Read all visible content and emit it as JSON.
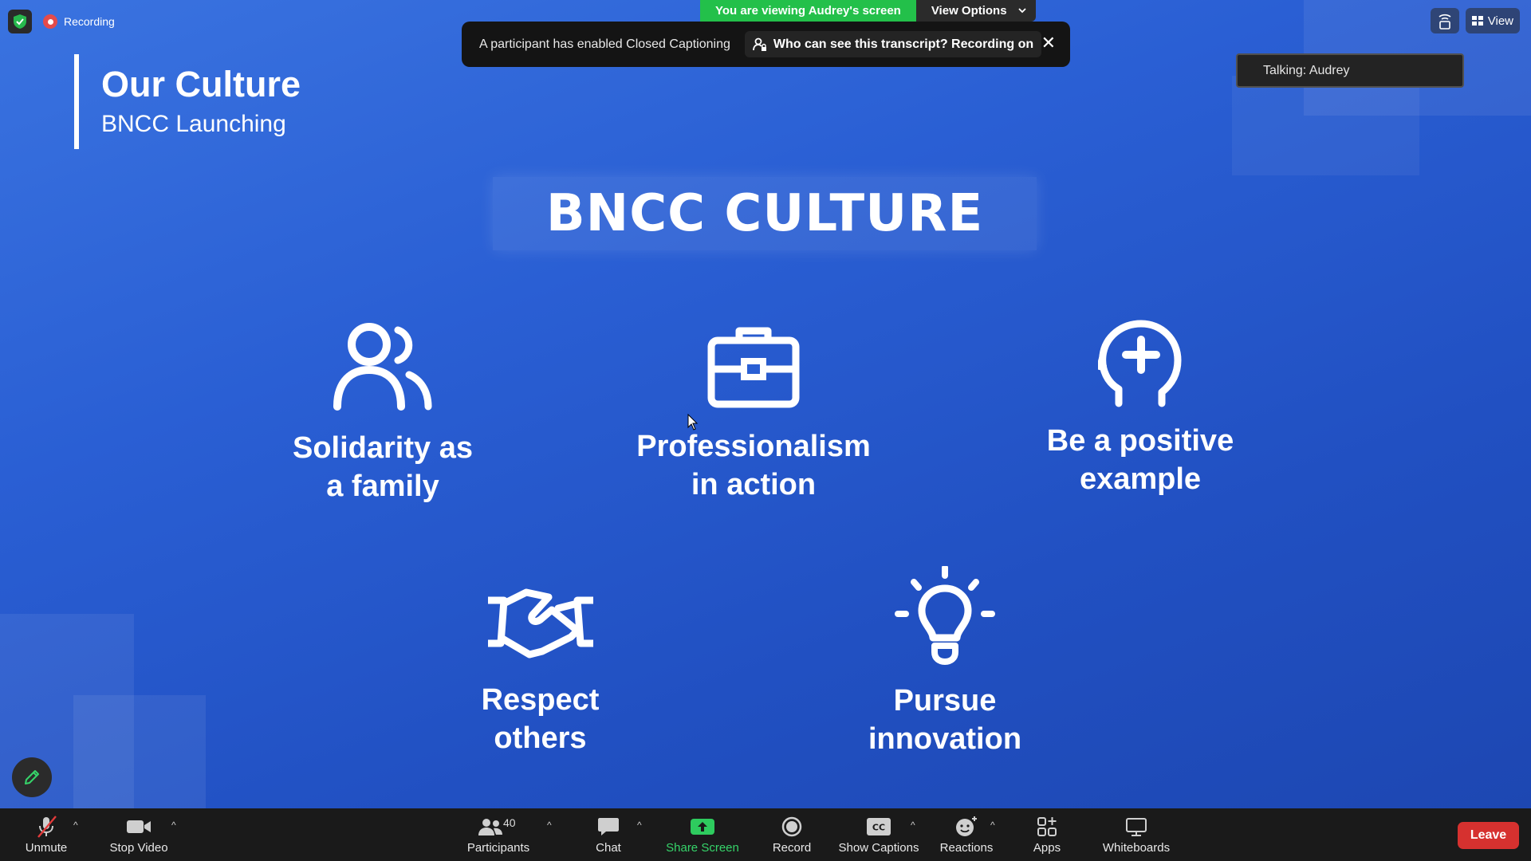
{
  "recording": {
    "label": "Recording"
  },
  "viewing_bar": {
    "label": "You are viewing Audrey's screen",
    "options_label": "View Options"
  },
  "caption_banner": {
    "message": "A participant has enabled Closed Captioning",
    "transcript_label": "Who can see this transcript? Recording on",
    "close_symbol": "✕"
  },
  "talking": {
    "label": "Talking: Audrey"
  },
  "top_right": {
    "view_label": "View"
  },
  "slide": {
    "heading": {
      "title": "Our Culture",
      "subtitle": "BNCC Launching"
    },
    "banner": "BNCC CULTURE",
    "values": [
      {
        "icon": "people-icon",
        "label_line1": "Solidarity as",
        "label_line2": "a family"
      },
      {
        "icon": "briefcase-icon",
        "label_line1": "Professionalism",
        "label_line2": "in action"
      },
      {
        "icon": "head-plus-icon",
        "label_line1": "Be a positive",
        "label_line2": "example"
      },
      {
        "icon": "handshake-icon",
        "label_line1": "Respect",
        "label_line2": "others"
      },
      {
        "icon": "lightbulb-icon",
        "label_line1": "Pursue",
        "label_line2": "innovation"
      }
    ]
  },
  "toolbar": {
    "unmute": "Unmute",
    "stop_video": "Stop Video",
    "participants": "Participants",
    "participants_count": "40",
    "chat": "Chat",
    "share_screen": "Share Screen",
    "record": "Record",
    "show_captions": "Show Captions",
    "reactions": "Reactions",
    "apps": "Apps",
    "whiteboards": "Whiteboards",
    "leave": "Leave"
  },
  "colors": {
    "slide_background": "#2a5fd4",
    "viewing_green": "#23c04a",
    "leave_red": "#d6312f",
    "toolbar_bg": "#1a1a1a"
  }
}
